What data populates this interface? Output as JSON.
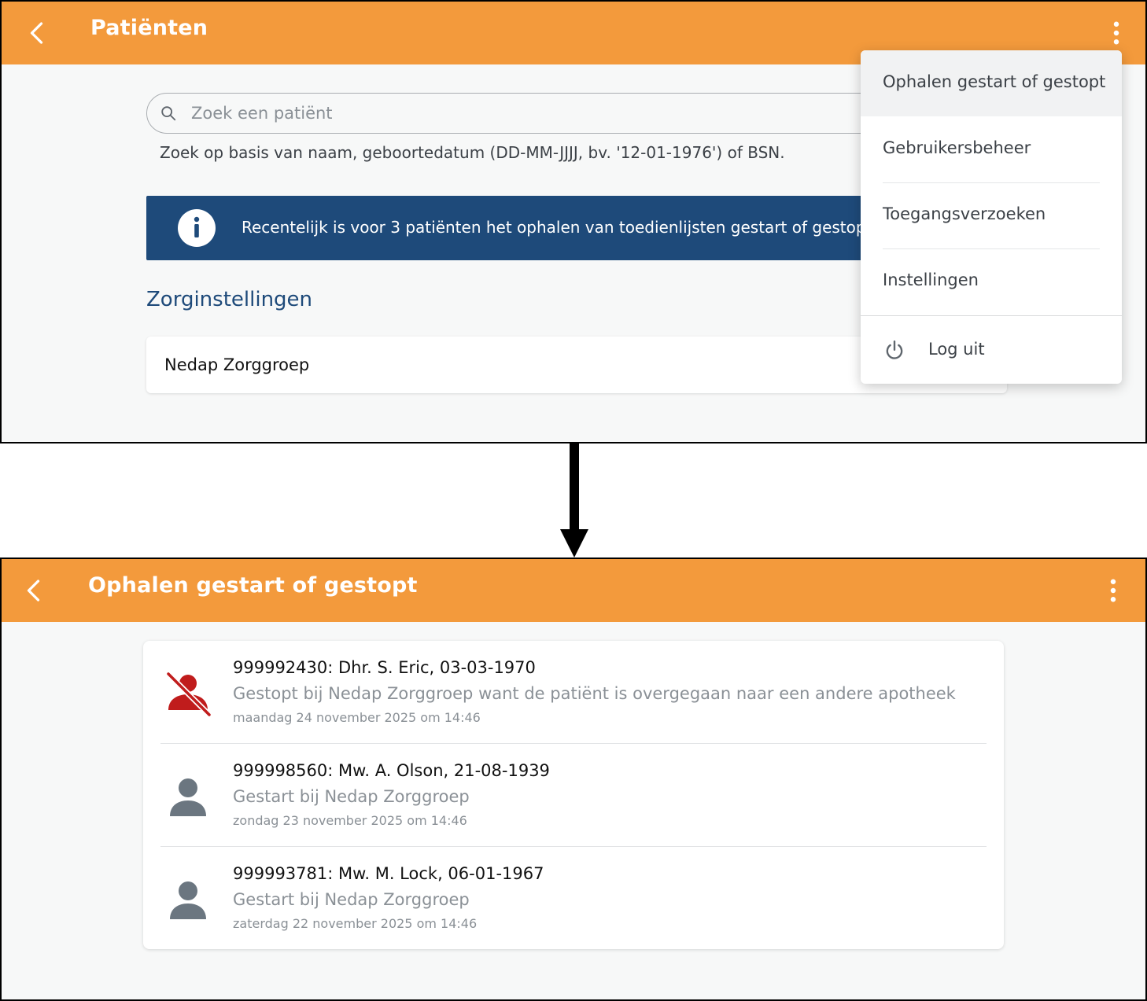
{
  "colors": {
    "appbar": "#f39a3c",
    "banner": "#1e4a7a",
    "section_title": "#1e4a7a",
    "stopped_icon": "#c01c1c",
    "person_icon": "#6b7680",
    "muted_text": "#8a9096"
  },
  "screen1": {
    "header": {
      "title": "Patiënten",
      "back_icon": "chevron-left-icon",
      "more_icon": "more-vertical-icon"
    },
    "search": {
      "placeholder": "Zoek een patiënt",
      "value": "",
      "icon": "search-icon",
      "hint": "Zoek op basis van naam, geboortedatum (DD-MM-JJJJ, bv. '12-01-1976') of BSN."
    },
    "banner": {
      "icon": "info-icon",
      "text": "Recentelijk is voor 3 patiënten het ophalen van toedienlijsten gestart of gestopt."
    },
    "section_title": "Zorginstellingen",
    "organizations": [
      {
        "name": "Nedap Zorggroep"
      }
    ],
    "menu": {
      "items": [
        {
          "label": "Ophalen gestart of gestopt"
        },
        {
          "label": "Gebruikersbeheer"
        },
        {
          "label": "Toegangsverzoeken"
        },
        {
          "label": "Instellingen"
        }
      ],
      "logout": {
        "label": "Log uit",
        "icon": "power-icon"
      }
    }
  },
  "screen2": {
    "header": {
      "title": "Ophalen gestart of gestopt",
      "back_icon": "chevron-left-icon",
      "more_icon": "more-vertical-icon"
    },
    "events": [
      {
        "patient": "999992430: Dhr. S. Eric, 03-03-1970",
        "status": "Gestopt bij Nedap Zorggroep want de patiënt is overgegaan naar een andere apotheek",
        "date": "maandag 24 november 2025 om 14:46",
        "icon": "person-off-icon"
      },
      {
        "patient": "999998560: Mw. A. Olson, 21-08-1939",
        "status": "Gestart bij Nedap Zorggroep",
        "date": "zondag 23 november 2025 om 14:46",
        "icon": "person-icon"
      },
      {
        "patient": "999993781: Mw. M. Lock, 06-01-1967",
        "status": "Gestart bij Nedap Zorggroep",
        "date": "zaterdag 22 november 2025 om 14:46",
        "icon": "person-icon"
      }
    ]
  }
}
